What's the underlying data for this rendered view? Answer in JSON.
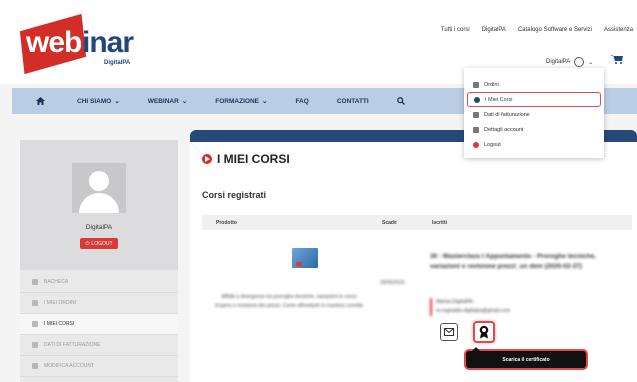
{
  "brand": {
    "logo_main_a": "web",
    "logo_main_b": "inar",
    "logo_sub": "DigitalPA"
  },
  "top_links": [
    "Tutti i corsi",
    "DigitalPA",
    "Catalogo Software e Servizi",
    "Assistenza"
  ],
  "account": {
    "name": "DigitalPA"
  },
  "nav": {
    "items": [
      "CHI SIAMO",
      "WEBINAR",
      "FORMAZIONE",
      "FAQ",
      "CONTATTI"
    ]
  },
  "account_menu": {
    "items": [
      "Ordini",
      "I Miei Corsi",
      "Dati di fatturazione",
      "Dettagli account",
      "Logout"
    ],
    "active_index": 1
  },
  "sidebar": {
    "username": "DigitalPA",
    "logout_label": "LOGOUT",
    "items": [
      "BACHECA",
      "I MIEI ORDINI",
      "I MIEI CORSI",
      "DATI DI FATTURAZIONE",
      "MODIFICA ACCOUNT"
    ],
    "active_index": 2
  },
  "main": {
    "title": "I MIEI CORSI",
    "subtitle": "Corsi registrati",
    "columns": {
      "product": "Prodotto",
      "expiry": "Scade",
      "enrolled": "Iscritti"
    },
    "row": {
      "description": "Affidiè a divergenze tra proroghe tecniche, variazioni in corso d'opera e revisione dei prezzi. Come affrontarle in maniera corretta",
      "date": "28/05/2025",
      "course": "30 - Masterclass I Appuntamento - Proroghe tecniche, variazioni e revisione prezzi_un dem (2025-02-27)",
      "user_name": "Marisa DigitalPA -",
      "user_email": "m.reginaldo.digitalpa@gmail.com"
    },
    "tooltip": "Scarica il certificato"
  }
}
